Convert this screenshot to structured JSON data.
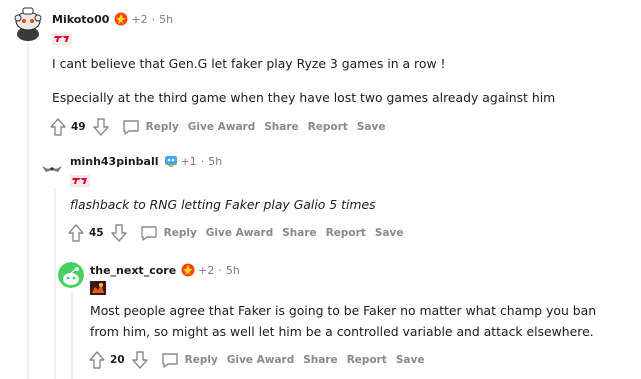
{
  "comments": [
    {
      "username": "Mikoto00",
      "award_count": "+2",
      "separator": "·",
      "time": "5h",
      "paragraphs": [
        "I cant believe that Gen.G let faker play Ryze 3 games in a row !",
        "Especially at the third game when they have lost two games already against him"
      ],
      "score": "49"
    },
    {
      "username": "minh43pinball",
      "award_count": "+1",
      "separator": "·",
      "time": "5h",
      "paragraphs": [
        "flashback to RNG letting Faker play Galio 5 times"
      ],
      "score": "45"
    },
    {
      "username": "the_next_core",
      "award_count": "+2",
      "separator": "·",
      "time": "5h",
      "paragraphs": [
        "Most people agree that Faker is going to be Faker no matter what champ you ban from him, so might as well let him be a controlled variable and attack elsewhere."
      ],
      "score": "20"
    }
  ],
  "actions": {
    "reply": "Reply",
    "give_award": "Give Award",
    "share": "Share",
    "report": "Report",
    "save": "Save"
  },
  "colors": {
    "t1_red": "#e2012d",
    "upvote_gray": "#878a8c",
    "thread_line": "#edeff1"
  }
}
